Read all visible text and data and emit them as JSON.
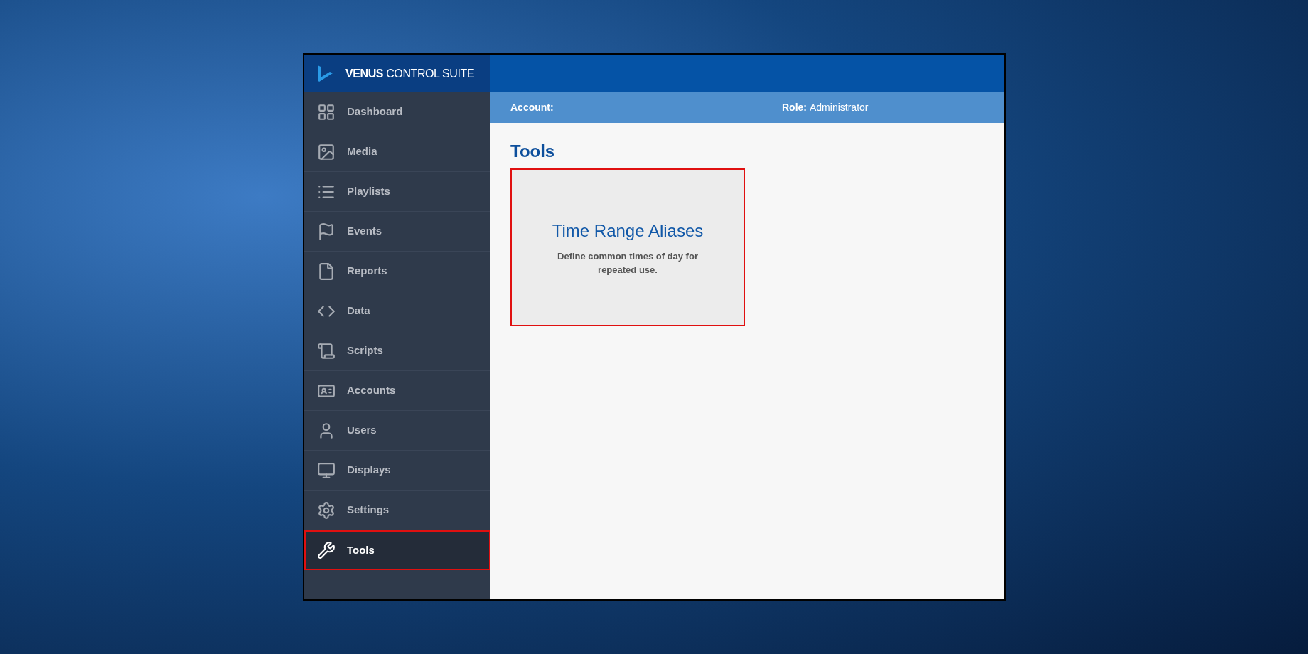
{
  "app": {
    "logo_text": "**VENUS** CONTROL SUITE"
  },
  "sidebar": {
    "items": [
      {
        "label": "Dashboard",
        "selected": false
      },
      {
        "label": "Media",
        "selected": false
      },
      {
        "label": "Playlists",
        "selected": false
      },
      {
        "label": "Events",
        "selected": false
      },
      {
        "label": "Reports",
        "selected": false
      },
      {
        "label": "Data",
        "selected": false
      },
      {
        "label": "Scripts",
        "selected": false
      },
      {
        "label": "Accounts",
        "selected": false
      },
      {
        "label": "Users",
        "selected": false
      },
      {
        "label": "Displays",
        "selected": false
      },
      {
        "label": "Settings",
        "selected": false
      },
      {
        "label": "Tools",
        "selected": true
      }
    ]
  },
  "info_bar": {
    "account_label": "Account:",
    "role_label": "Role:",
    "role_value": "Administrator"
  },
  "page": {
    "title": "Tools",
    "cards": [
      {
        "title": "Time Range Aliases",
        "description": "Define common times of day for repeated use.",
        "highlighted": true
      }
    ]
  }
}
